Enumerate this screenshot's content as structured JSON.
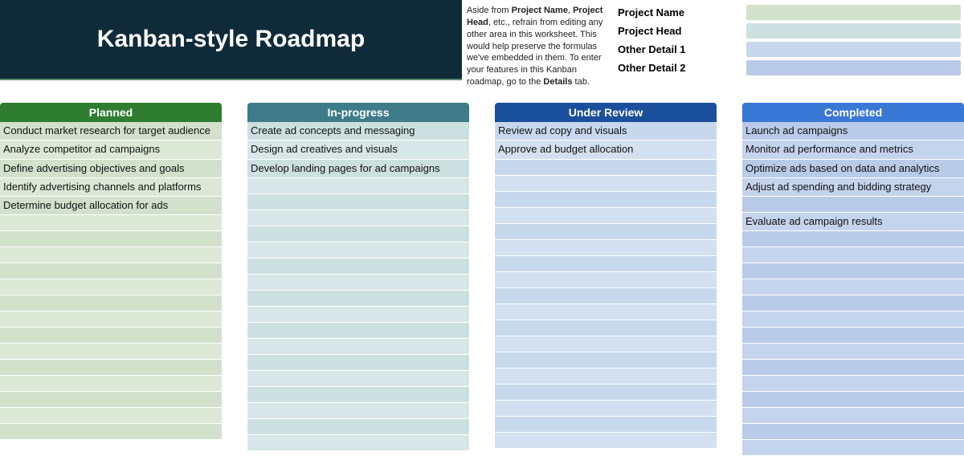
{
  "header": {
    "title": "Kanban-style Roadmap",
    "instructions_parts": {
      "p1": "Aside from ",
      "b1": "Project Name",
      "p2": ", ",
      "b2": "Project Head",
      "p3": ", etc., refrain from editing any other area in this worksheet. This would help preserve the formulas we've embedded in them. To enter your features in this Kanban roadmap, go to the ",
      "b3": "Details",
      "p4": " tab."
    },
    "meta_labels": [
      "Project Name",
      "Project Head",
      "Other Detail 1",
      "Other Detail 2"
    ]
  },
  "columns": [
    {
      "key": "planned",
      "title": "Planned",
      "cards": [
        "Conduct market research for target audience",
        "Analyze competitor ad campaigns",
        "Define advertising objectives and goals",
        "Identify advertising channels and platforms",
        "Determine budget allocation for ads"
      ],
      "empty_rows": 14
    },
    {
      "key": "inprog",
      "title": "In-progress",
      "cards": [
        "Create ad concepts and messaging",
        "Design ad creatives and visuals",
        "Develop landing pages for ad campaigns"
      ],
      "empty_rows": 17
    },
    {
      "key": "review",
      "title": "Under Review",
      "cards": [
        "Review ad copy and visuals",
        "Approve ad budget allocation"
      ],
      "empty_rows": 18
    },
    {
      "key": "done",
      "title": "Completed",
      "cards": [
        "Launch ad campaigns",
        "Monitor ad performance and metrics",
        "Optimize ads based on data and analytics",
        "Adjust ad spending and bidding strategy",
        "",
        "Evaluate ad campaign results"
      ],
      "empty_rows": 14
    }
  ]
}
